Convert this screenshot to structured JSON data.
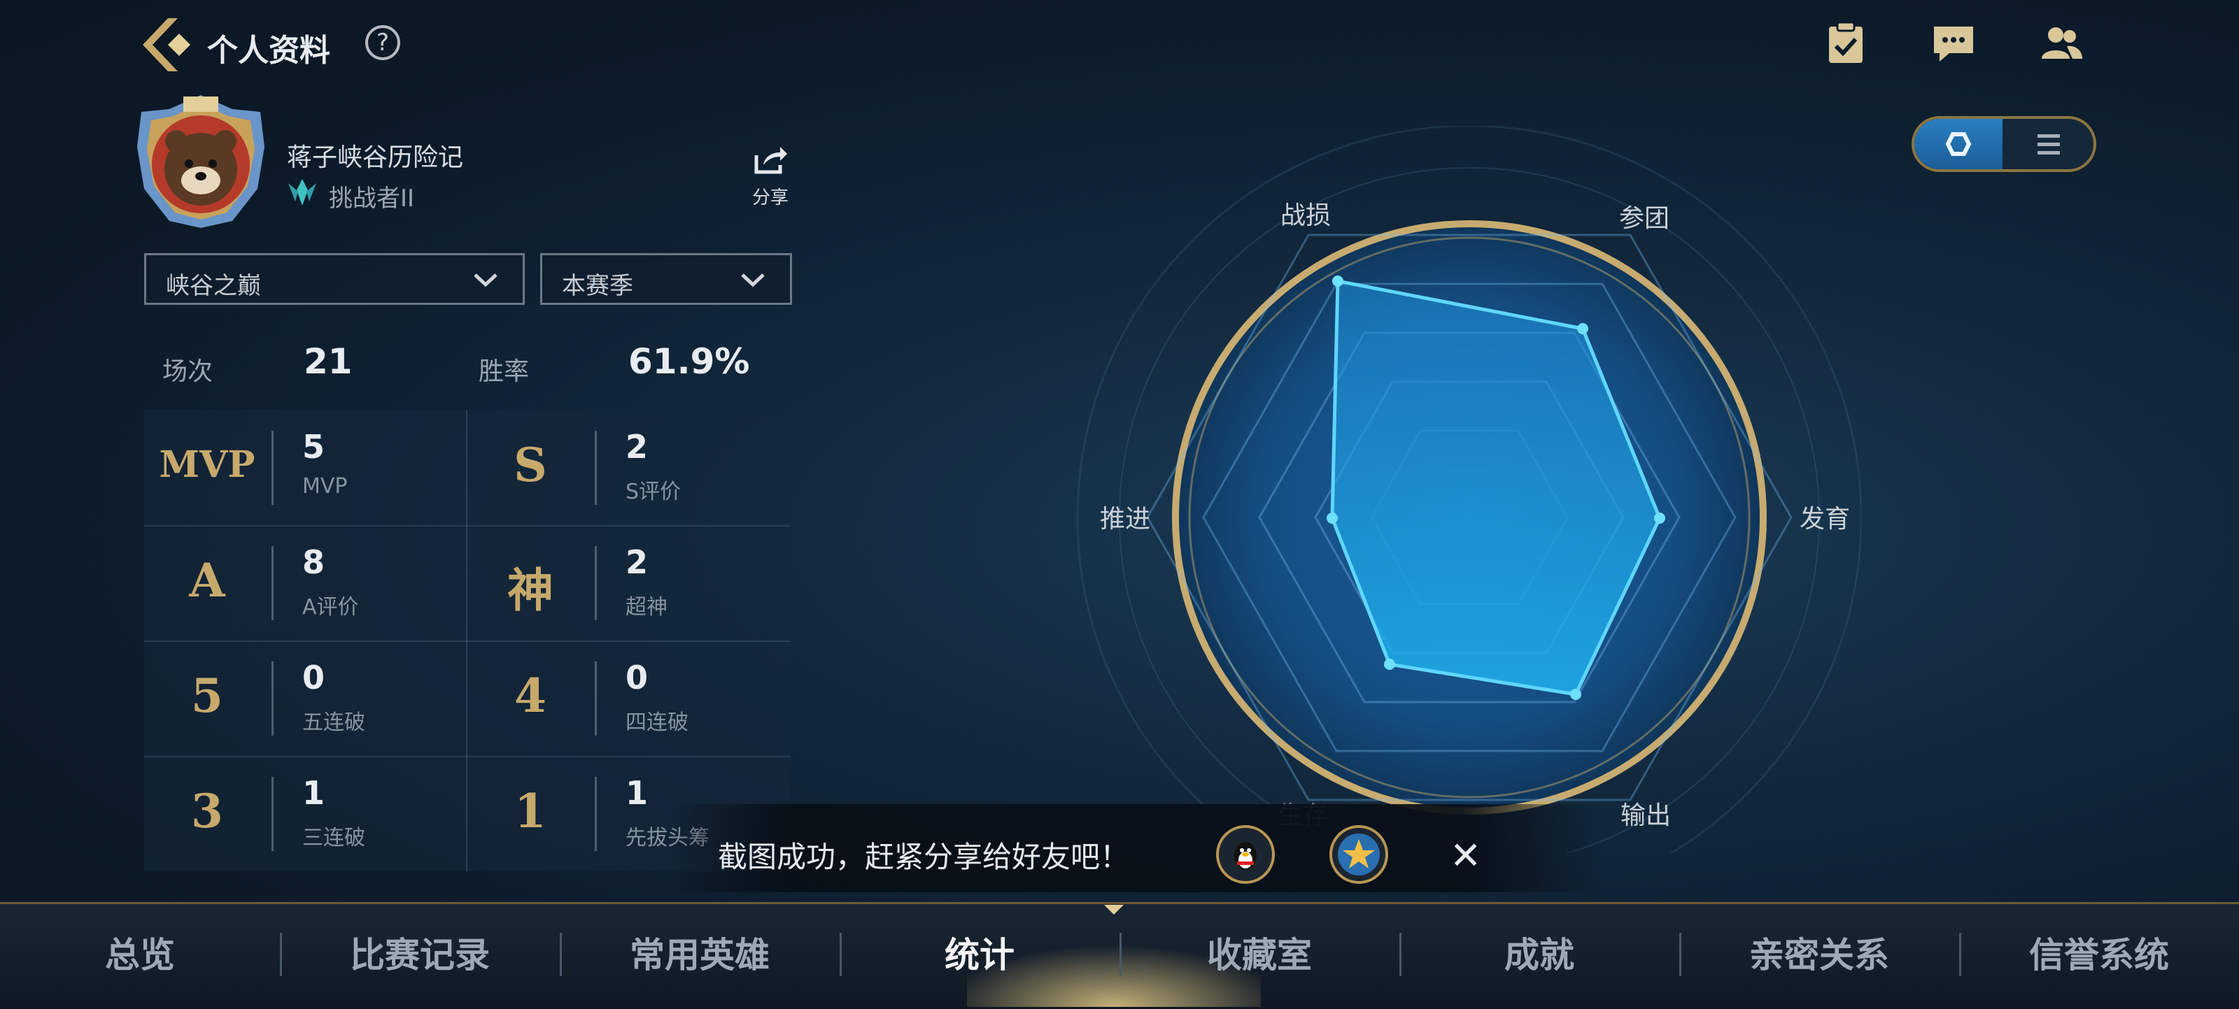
{
  "header": {
    "title": "个人资料",
    "help_glyph": "?",
    "icons": [
      "back-icon",
      "help-icon",
      "task-checklist-icon",
      "chat-icon",
      "friends-icon"
    ]
  },
  "profile": {
    "username": "蒋子峡谷历险记",
    "rank": "挑战者II",
    "share_label": "分享"
  },
  "filters": {
    "mode": "峡谷之巅",
    "season": "本赛季"
  },
  "summary": {
    "games_label": "场次",
    "games_value": "21",
    "winrate_label": "胜率",
    "winrate_value": "61.9%"
  },
  "stats": [
    {
      "badge": "MVP",
      "value": "5",
      "label": "MVP"
    },
    {
      "badge": "S",
      "value": "2",
      "label": "S评价"
    },
    {
      "badge": "A",
      "value": "8",
      "label": "A评价"
    },
    {
      "badge": "神",
      "value": "2",
      "label": "超神"
    },
    {
      "badge": "5",
      "value": "0",
      "label": "五连破"
    },
    {
      "badge": "4",
      "value": "0",
      "label": "四连破"
    },
    {
      "badge": "3",
      "value": "1",
      "label": "三连破"
    },
    {
      "badge": "1",
      "value": "1",
      "label": "先拔头筹"
    }
  ],
  "radar": {
    "axes": [
      "战损",
      "参团",
      "发育",
      "输出",
      "生存",
      "推进"
    ]
  },
  "toast": {
    "message": "截图成功，赶紧分享给好友吧！",
    "close_glyph": "✕"
  },
  "nav": {
    "items": [
      "总览",
      "比赛记录",
      "常用英雄",
      "统计",
      "收藏室",
      "成就",
      "亲密关系",
      "信誉系统"
    ],
    "active_index": 3
  },
  "colors": {
    "gold": "#c7a96c",
    "radar_fill": "#1aa3e6",
    "accent_blue": "#2a7fc0"
  }
}
